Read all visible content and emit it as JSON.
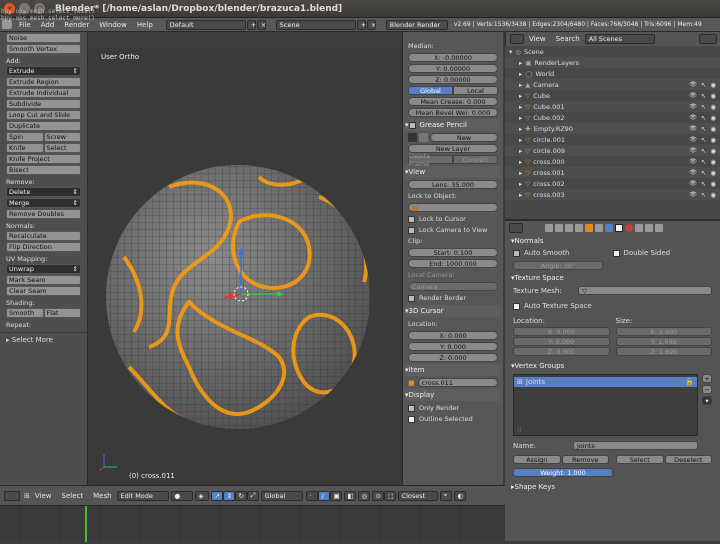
{
  "window": {
    "title": "Blender* [/home/aslan/Dropbox/blender/brazuca1.blend]"
  },
  "console": {
    "line1": "bpy.ops.mesh.select_less()",
    "line2": "bpy.ops.mesh.select_more()"
  },
  "infobar": {
    "menus": [
      "File",
      "Add",
      "Render",
      "Window",
      "Help"
    ],
    "screen": "Default",
    "scene": "Scene",
    "engine": "Blender Render",
    "stats": "v2.69 | Verts:1536/3438 | Edges:2304/6480 | Faces:768/3048 | Tris:6096 | Mem:49"
  },
  "toolshelf": {
    "noise": "Noise",
    "smooth_vertex": "Smooth Vertex",
    "add_label": "Add:",
    "extrude": "Extrude",
    "extrude_region": "Extrude Region",
    "extrude_individual": "Extrude Individual",
    "subdivide": "Subdivide",
    "loop_cut": "Loop Cut and Slide",
    "duplicate": "Duplicate",
    "spin": "Spin",
    "screw": "Screw",
    "knife": "Knife",
    "select": "Select",
    "knife_project": "Knife Project",
    "bisect": "Bisect",
    "remove_label": "Remove:",
    "delete": "Delete",
    "merge": "Merge",
    "remove_doubles": "Remove Doubles",
    "normals_label": "Normals:",
    "recalculate": "Recalculate",
    "flip_direction": "Flip Direction",
    "uv_label": "UV Mapping:",
    "unwrap": "Unwrap",
    "mark_seam": "Mark Seam",
    "clear_seam": "Clear Seam",
    "shading_label": "Shading:",
    "smooth": "Smooth",
    "flat": "Flat",
    "repeat_label": "Repeat:",
    "select_more": "Select More"
  },
  "viewport": {
    "label": "User Ortho",
    "object": "(0) cross.011"
  },
  "npanel": {
    "median": "Median:",
    "x": "X: -0.00000",
    "y": "Y: 0.00000",
    "z": "Z: 0.00000",
    "global": "Global",
    "local": "Local",
    "mean_crease": "Mean Crease: 0.000",
    "mean_bevel": "Mean Bevel Wei: 0.000",
    "grease_pencil": "Grease Pencil",
    "new": "New",
    "new_layer": "New Layer",
    "delete_frame": "Delete Frame",
    "convert": "Convert",
    "view": "View",
    "lens": "Lens: 35.000",
    "lock_to_object": "Lock to Object:",
    "lock_to_cursor": "Lock to Cursor",
    "lock_camera": "Lock Camera to View",
    "clip": "Clip:",
    "start": "Start: 0.100",
    "end": "End: 1000.000",
    "local_camera": "Local Camera:",
    "camera": "Camera",
    "render_border": "Render Border",
    "cursor": "3D Cursor",
    "location": "Location:",
    "cx": "X: 0.000",
    "cy": "Y: 0.000",
    "cz": "Z: 0.000",
    "item": "Item",
    "item_name": "cross.011",
    "display": "Display",
    "only_render": "Only Render",
    "outline_selected": "Outline Selected"
  },
  "outliner": {
    "view": "View",
    "search": "Search",
    "scenes": "All Scenes",
    "rows": [
      "Scene",
      "RenderLayers",
      "World",
      "Camera",
      "Cube",
      "Cube.001",
      "Cube.002",
      "Empty.RZ90",
      "circle.001",
      "circle.009",
      "cross.000",
      "cross.001",
      "cross.002",
      "cross.003"
    ]
  },
  "props": {
    "normals": "Normals",
    "auto_smooth": "Auto Smooth",
    "double_sided": "Double Sided",
    "angle": "Angle: 30°",
    "texture_space": "Texture Space",
    "texture_mesh": "Texture Mesh:",
    "auto_texture_space": "Auto Texture Space",
    "location": "Location:",
    "size": "Size:",
    "lx": "X: 0.000",
    "ly": "Y: 0.000",
    "lz": "Z: 0.000",
    "sx": "X: 1.690",
    "sy": "Y: 1.690",
    "sz": "Z: 1.690",
    "vertex_groups": "Vertex Groups",
    "group": "Joints",
    "name_label": "Name:",
    "name_value": "Joints",
    "assign": "Assign",
    "remove": "Remove",
    "select": "Select",
    "deselect": "Deselect",
    "weight": "Weight: 1.000",
    "shape_keys": "Shape Keys"
  },
  "vphead": {
    "view": "View",
    "select": "Select",
    "mesh": "Mesh",
    "mode": "Edit Mode",
    "orientation": "Global",
    "snap": "Closest"
  },
  "colors": {
    "selection": "#f39c12",
    "active_row": "#5680c2",
    "accent": "#f0a030"
  }
}
